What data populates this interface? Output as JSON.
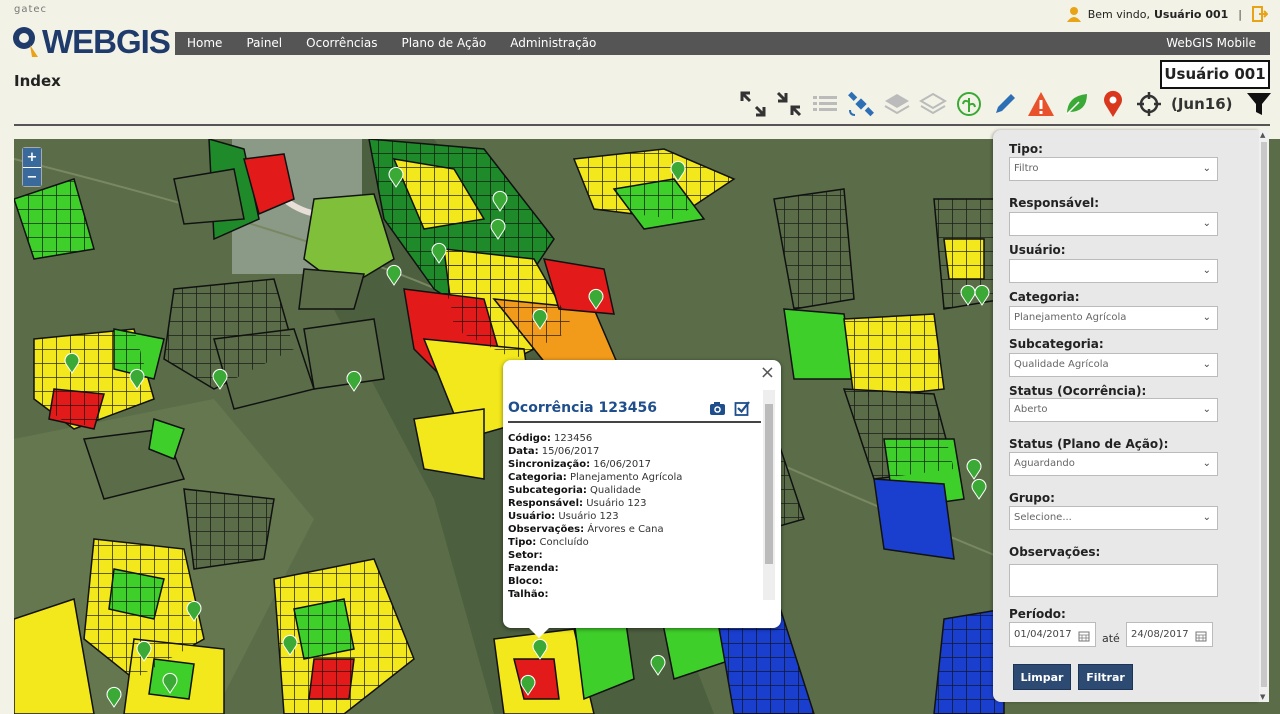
{
  "brand": {
    "vendor": "gatec",
    "logo_text": "WEBGIS"
  },
  "user_bar": {
    "greeting": "Bem vindo,",
    "user": "Usuário 001",
    "separator": "|"
  },
  "nav": {
    "items": [
      "Home",
      "Painel",
      "Ocorrências",
      "Plano de Ação",
      "Administração"
    ],
    "right": "WebGIS Mobile"
  },
  "page": {
    "title": "Index",
    "user_box": "Usuário 001"
  },
  "toolbar": {
    "icons": [
      "expand-icon",
      "collapse-icon",
      "list-icon",
      "satellite-icon",
      "layers-icon",
      "layers-outline-icon",
      "leaf-circle-icon",
      "pencil-icon",
      "warning-icon",
      "leaf-icon",
      "map-marker-icon",
      "crosshair-icon",
      "filter-icon"
    ],
    "period": "(Jun16)",
    "colors": {
      "warning": "#e8532b",
      "leaf": "#3aa935",
      "marker": "#d9381e",
      "pencil": "#2d6fb5",
      "satellite": "#2d6fb5"
    }
  },
  "map": {
    "zoom_in": "+",
    "zoom_out": "−"
  },
  "popup": {
    "close": "×",
    "title": "Ocorrência 123456",
    "fields": [
      {
        "label": "Código:",
        "value": "123456"
      },
      {
        "label": "Data:",
        "value": "15/06/2017"
      },
      {
        "label": "Sincronização:",
        "value": "16/06/2017"
      },
      {
        "label": "Categoria:",
        "value": "Planejamento Agrícola"
      },
      {
        "label": "Subcategoria:",
        "value": "Qualidade"
      },
      {
        "label": "Responsável:",
        "value": "Usuário 123"
      },
      {
        "label": "Usuário:",
        "value": "Usuário 123"
      },
      {
        "label": "Observações:",
        "value": "Árvores e Cana"
      },
      {
        "label": "Tipo:",
        "value": "Concluído"
      },
      {
        "label": "Setor:",
        "value": ""
      },
      {
        "label": "Fazenda:",
        "value": ""
      },
      {
        "label": "Bloco:",
        "value": ""
      },
      {
        "label": "Talhão:",
        "value": ""
      }
    ]
  },
  "filter": {
    "tipo": {
      "label": "Tipo:",
      "value": "Filtro"
    },
    "responsavel": {
      "label": "Responsável:",
      "value": ""
    },
    "usuario": {
      "label": "Usuário:",
      "value": ""
    },
    "categoria": {
      "label": "Categoria:",
      "value": "Planejamento Agrícola"
    },
    "subcategoria": {
      "label": "Subcategoria:",
      "value": "Qualidade Agrícola"
    },
    "status_ocorrencia": {
      "label": "Status (Ocorrência):",
      "value": "Aberto"
    },
    "status_plano": {
      "label": "Status (Plano de Ação):",
      "value": "Aguardando"
    },
    "grupo": {
      "label": "Grupo:",
      "value": "Selecione..."
    },
    "observacoes": {
      "label": "Observações:"
    },
    "periodo": {
      "label": "Período:",
      "from": "01/04/2017",
      "separator": "até",
      "to": "24/08/2017"
    },
    "clear_button": "Limpar",
    "filter_button": "Filtrar"
  }
}
